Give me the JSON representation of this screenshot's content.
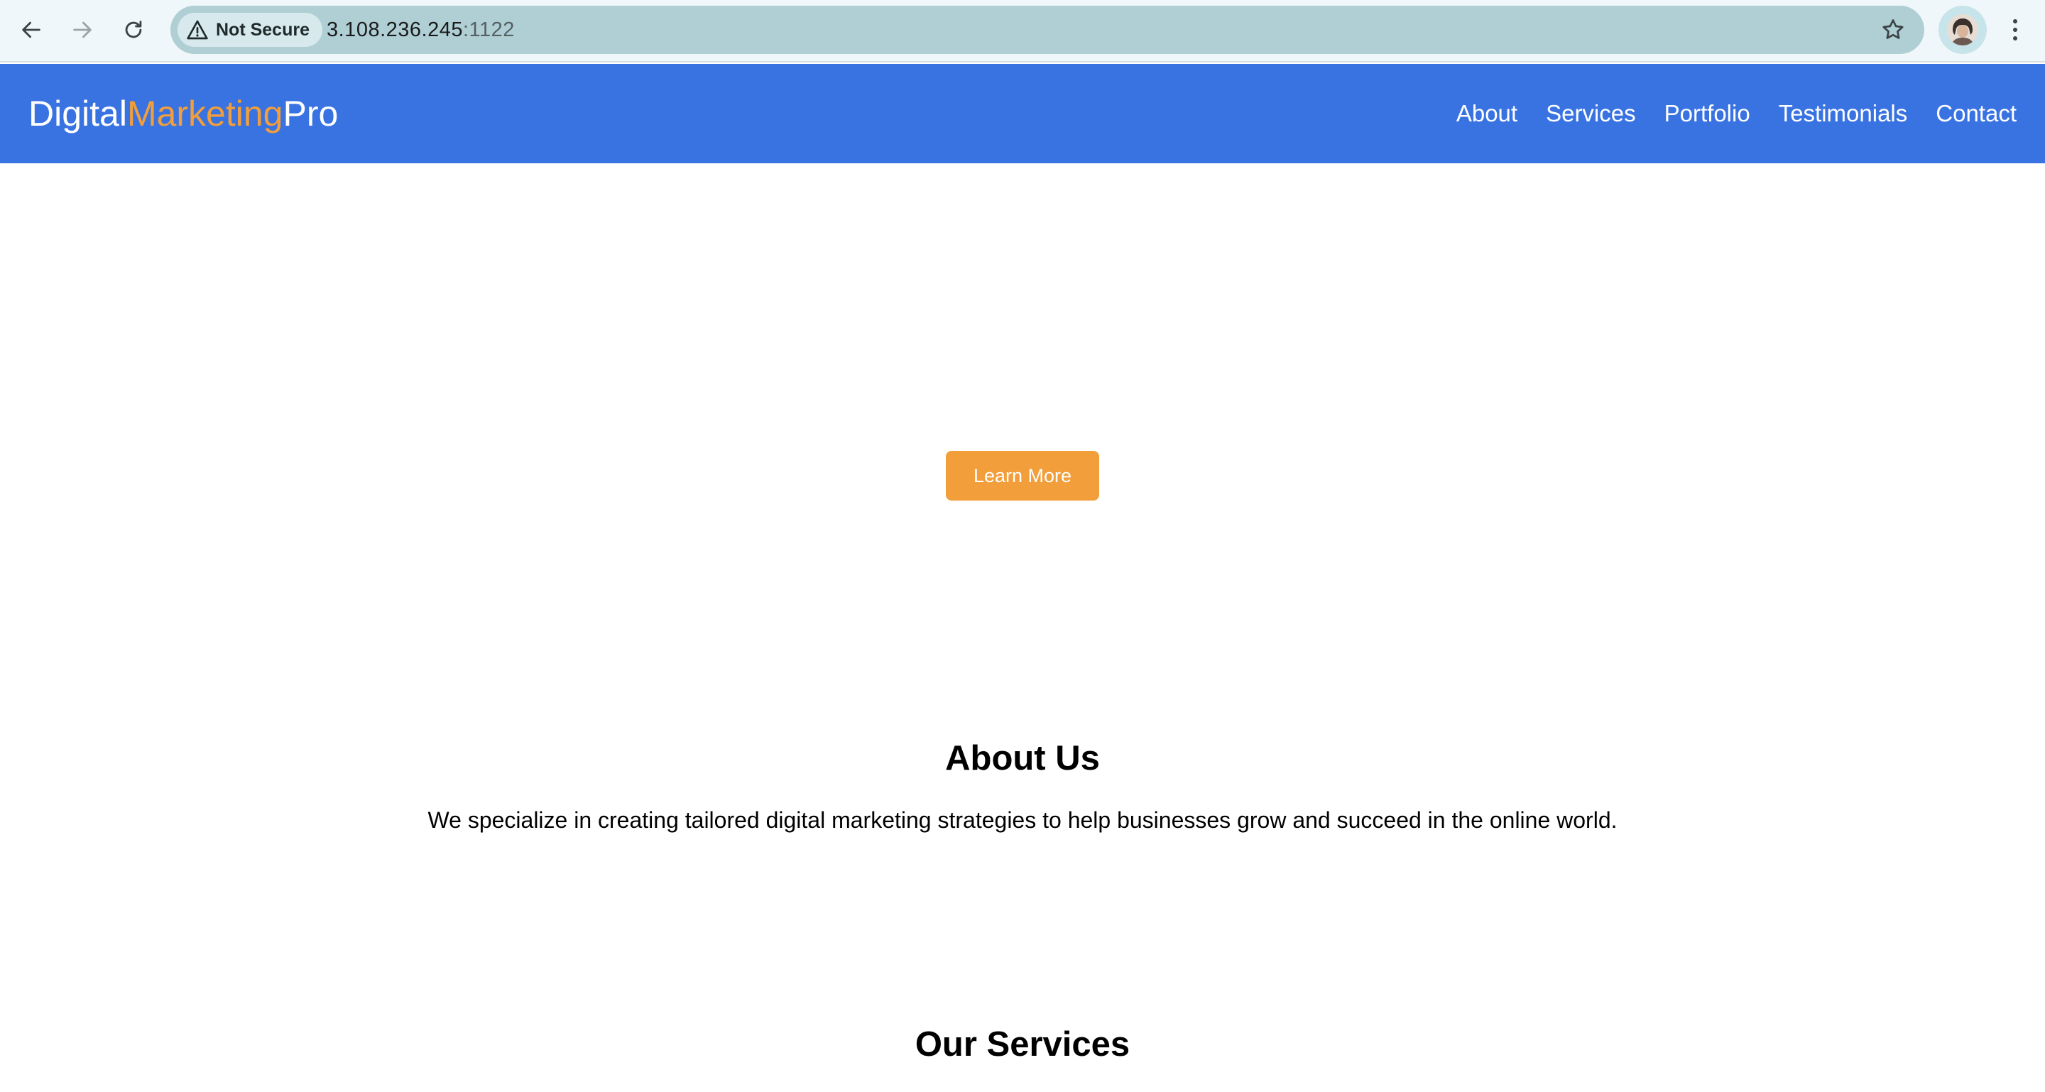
{
  "browser": {
    "security_label": "Not Secure",
    "url_host": "3.108.236.245",
    "url_port": ":1122",
    "icons": [
      "back-arrow-icon",
      "forward-arrow-icon",
      "reload-icon",
      "warning-triangle-icon",
      "star-icon",
      "kebab-menu-icon"
    ]
  },
  "site": {
    "logo": {
      "part1": "Digital",
      "part2": "Marketing",
      "part3": "Pro"
    },
    "nav": [
      {
        "label": "About"
      },
      {
        "label": "Services"
      },
      {
        "label": "Portfolio"
      },
      {
        "label": "Testimonials"
      },
      {
        "label": "Contact"
      }
    ],
    "hero": {
      "cta_label": "Learn More"
    },
    "about": {
      "title": "About Us",
      "text": "We specialize in creating tailored digital marketing strategies to help businesses grow and succeed in the online world."
    },
    "services": {
      "title": "Our Services"
    }
  },
  "colors": {
    "header_bg": "#3973e2",
    "accent_orange": "#f29e3a",
    "omnibox_bg": "#afcfd5"
  }
}
